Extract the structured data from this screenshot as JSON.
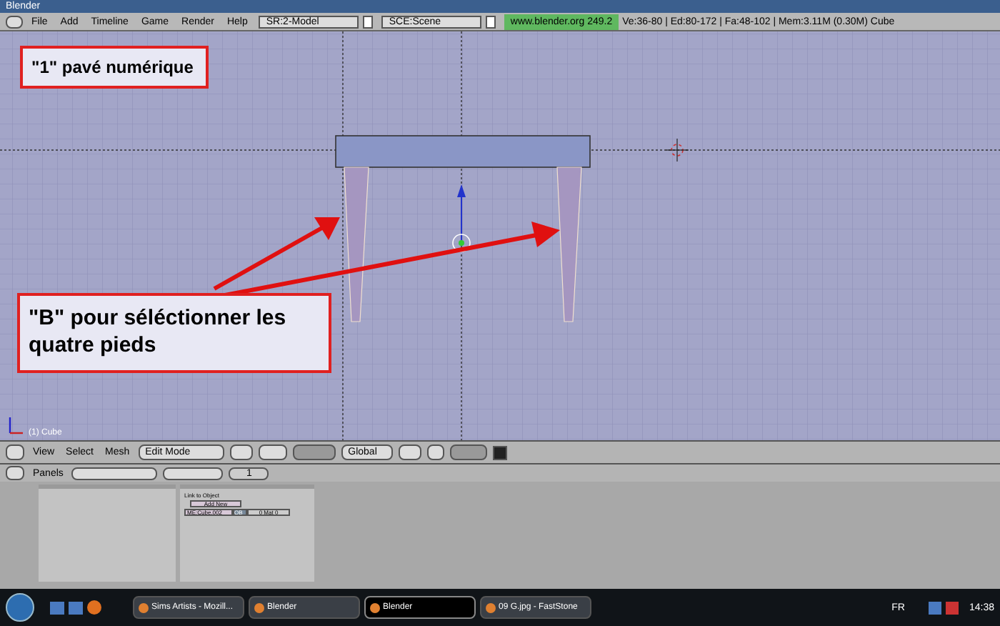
{
  "window": {
    "title": "Blender"
  },
  "menu_bar": {
    "items": [
      "File",
      "Add",
      "Timeline",
      "Game",
      "Render",
      "Help"
    ],
    "screen": "SR:2-Model",
    "scene": "SCE:Scene",
    "version": "www.blender.org 249.2",
    "stats": "Ve:36-80 | Ed:80-172 | Fa:48-102 | Mem:3.11M (0.30M) Cube"
  },
  "viewport": {
    "object_label": "(1) Cube",
    "annotations": [
      {
        "text": "\"1\" pavé numérique"
      },
      {
        "text": "\"B\" pour séléctionner les quatre pieds"
      }
    ]
  },
  "view3d_header": {
    "menus": [
      "View",
      "Select",
      "Mesh"
    ],
    "mode": "Edit Mode",
    "orientation": "Global"
  },
  "buttons_header": {
    "label": "Panels",
    "frame": "1"
  },
  "link_panel": {
    "title": "Link to Object",
    "button": "Add New",
    "mesh": "ME:Cube.002",
    "ob": "OB",
    "material": "0 Mat 0"
  },
  "taskbar": {
    "tasks": [
      {
        "label": "Sims Artists - Mozill...",
        "selected": false
      },
      {
        "label": "Blender",
        "selected": false
      },
      {
        "label": "Blender",
        "selected": true
      },
      {
        "label": "09 G.jpg - FastStone",
        "selected": false
      }
    ],
    "language": "FR",
    "clock": "14:38"
  }
}
